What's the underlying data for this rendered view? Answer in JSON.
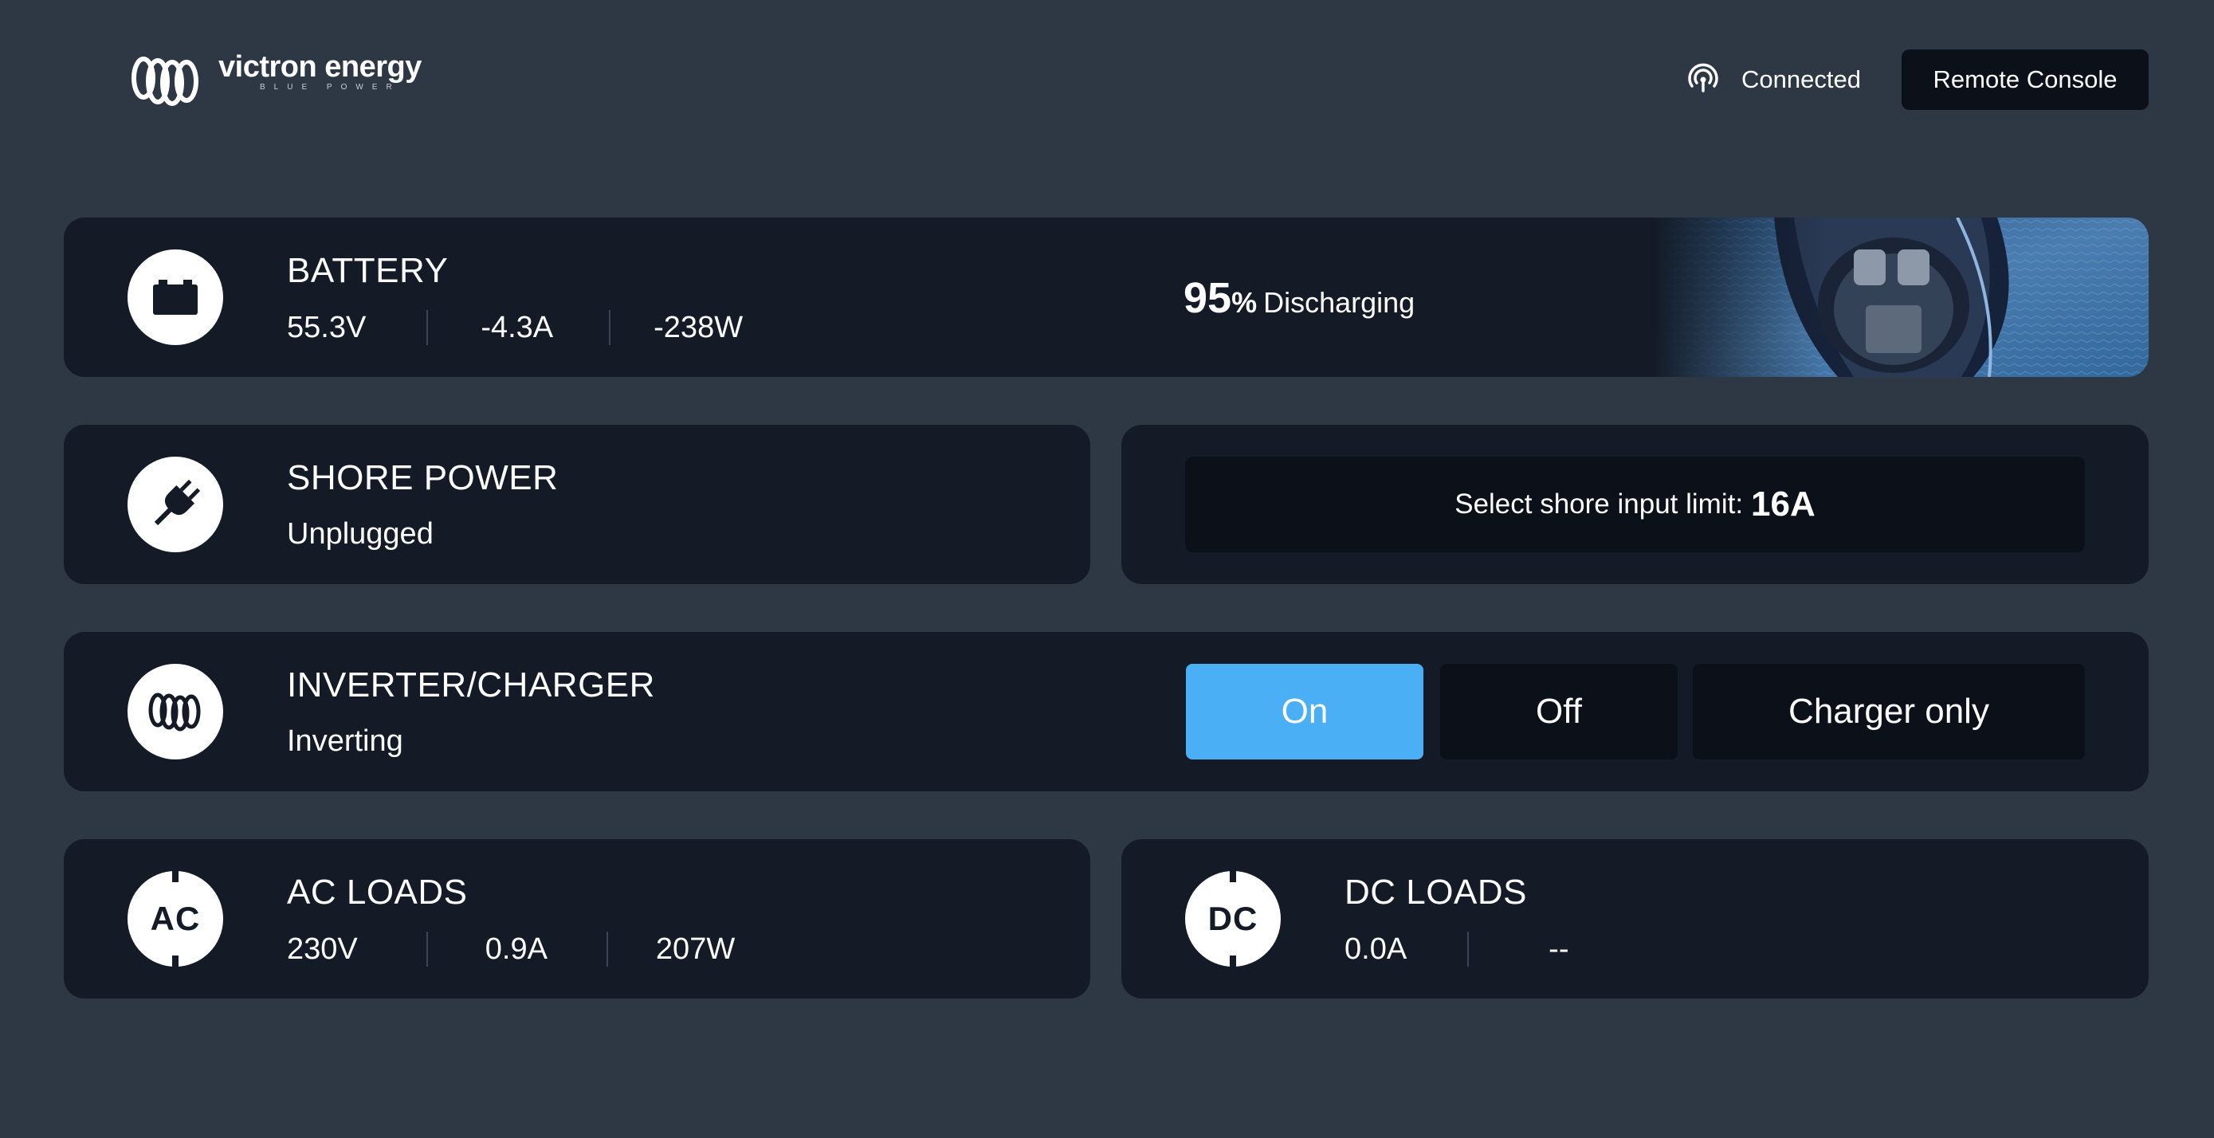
{
  "header": {
    "brand": "victron energy",
    "tagline": "BLUE POWER",
    "connection_status": "Connected",
    "remote_console_label": "Remote Console"
  },
  "battery": {
    "title": "BATTERY",
    "voltage": "55.3V",
    "current": "-4.3A",
    "power": "-238W",
    "soc_value": "95",
    "soc_unit": "%",
    "state": "Discharging"
  },
  "shore_power": {
    "title": "SHORE POWER",
    "status": "Unplugged",
    "limit_label": "Select shore input limit:",
    "limit_value": "16A"
  },
  "inverter": {
    "title": "INVERTER/CHARGER",
    "status": "Inverting",
    "modes": [
      "On",
      "Off",
      "Charger only"
    ],
    "active_mode": "On"
  },
  "ac_loads": {
    "title": "AC LOADS",
    "icon_label": "AC",
    "voltage": "230V",
    "current": "0.9A",
    "power": "207W"
  },
  "dc_loads": {
    "title": "DC LOADS",
    "icon_label": "DC",
    "current": "0.0A",
    "power": "--"
  },
  "colors": {
    "background": "#2e3744",
    "card": "#141b26",
    "button": "#0b1019",
    "accent": "#4aaff5"
  }
}
